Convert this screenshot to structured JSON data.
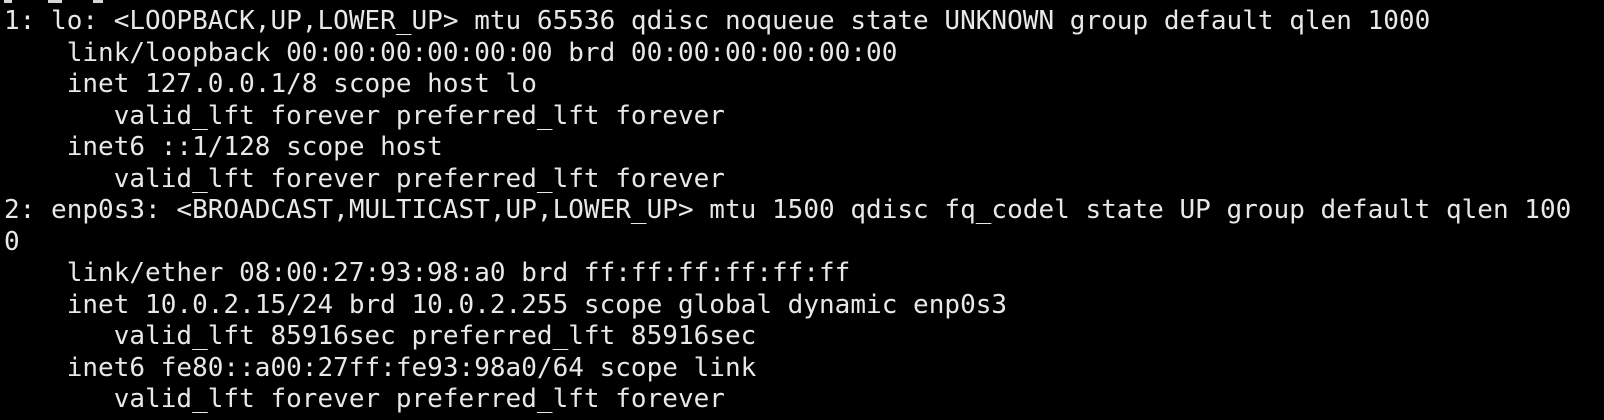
{
  "terminal": {
    "colors": {
      "background": "#000000",
      "foreground": "#e8e8e8"
    },
    "lines": [
      "1: lo: <LOOPBACK,UP,LOWER_UP> mtu 65536 qdisc noqueue state UNKNOWN group default qlen 1000",
      "    link/loopback 00:00:00:00:00:00 brd 00:00:00:00:00:00",
      "    inet 127.0.0.1/8 scope host lo",
      "       valid_lft forever preferred_lft forever",
      "    inet6 ::1/128 scope host",
      "       valid_lft forever preferred_lft forever",
      "2: enp0s3: <BROADCAST,MULTICAST,UP,LOWER_UP> mtu 1500 qdisc fq_codel state UP group default qlen 100",
      "0",
      "    link/ether 08:00:27:93:98:a0 brd ff:ff:ff:ff:ff:ff",
      "    inet 10.0.2.15/24 brd 10.0.2.255 scope global dynamic enp0s3",
      "       valid_lft 85916sec preferred_lft 85916sec",
      "    inet6 fe80::a00:27ff:fe93:98a0/64 scope link",
      "       valid_lft forever preferred_lft forever"
    ]
  }
}
